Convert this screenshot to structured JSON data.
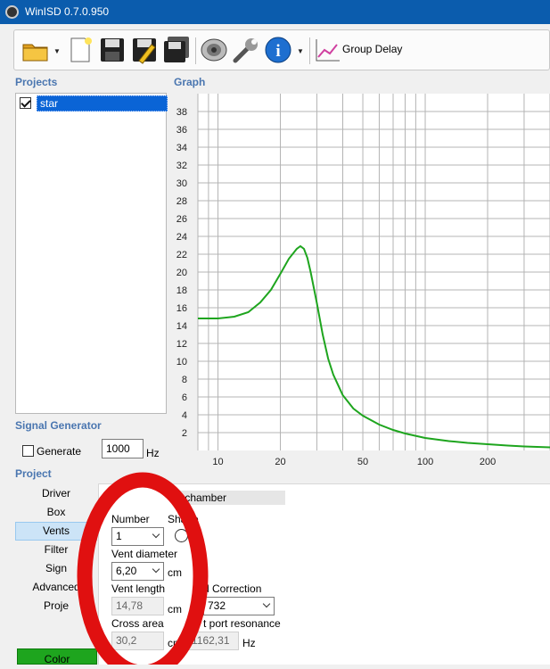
{
  "window": {
    "title": "WinISD 0.7.0.950"
  },
  "toolbar": {
    "group_delay_label": "Group Delay"
  },
  "projects": {
    "title": "Projects",
    "items": [
      {
        "name": "star",
        "checked": true
      }
    ]
  },
  "graph": {
    "title": "Graph",
    "chart_data": {
      "type": "line",
      "x_scale": "log",
      "xlim": [
        8,
        400
      ],
      "ylim": [
        0,
        40
      ],
      "y_ticks": [
        2,
        4,
        6,
        8,
        10,
        12,
        14,
        16,
        18,
        20,
        22,
        24,
        26,
        28,
        30,
        32,
        34,
        36,
        38
      ],
      "x_tick_labels": [
        "10",
        "20",
        "50",
        "100",
        "200"
      ],
      "x_ticks": [
        10,
        20,
        50,
        100,
        200
      ],
      "grid": true,
      "series": [
        {
          "color": "#1ea51e",
          "x": [
            8,
            10,
            12,
            14,
            16,
            18,
            20,
            22,
            24,
            25,
            26,
            27,
            28,
            30,
            32,
            34,
            36,
            40,
            45,
            50,
            60,
            70,
            80,
            100,
            130,
            160,
            200,
            250,
            300,
            400
          ],
          "y": [
            14.8,
            14.8,
            15.0,
            15.5,
            16.6,
            18.0,
            19.8,
            21.5,
            22.6,
            22.9,
            22.6,
            21.6,
            20.0,
            16.5,
            13.0,
            10.3,
            8.5,
            6.2,
            4.7,
            3.9,
            2.9,
            2.3,
            1.9,
            1.4,
            1.05,
            0.85,
            0.7,
            0.55,
            0.45,
            0.35
          ]
        }
      ]
    }
  },
  "signal_generator": {
    "title": "Signal Generator",
    "generate_label": "Generate",
    "frequency": "1000",
    "unit": "Hz"
  },
  "project": {
    "title": "Project",
    "nav": [
      "Driver",
      "Box",
      "Vents",
      "Filter",
      "Sign",
      "Advanced",
      "Proje"
    ],
    "selected": "Vents",
    "color_button": "Color"
  },
  "vents": {
    "chamber_label": "r chamber",
    "number_label": "Number",
    "number_value": "1",
    "shape_label": "Shape",
    "diameter_label": "Vent diameter",
    "diameter_value": "6,20",
    "diameter_unit": "cm",
    "length_label": "Vent length",
    "length_value": "14,78",
    "length_unit": "cm",
    "end_correction_label": "d Correction",
    "end_correction_value": "732",
    "cross_area_label": "Cross area",
    "cross_area_value": "30,2",
    "cross_area_unit": "cm",
    "resonance_label": "t port resonance",
    "resonance_value": "1162,31",
    "resonance_unit": "Hz"
  },
  "annotation": {
    "shape": "ellipse",
    "color": "#e01010"
  }
}
